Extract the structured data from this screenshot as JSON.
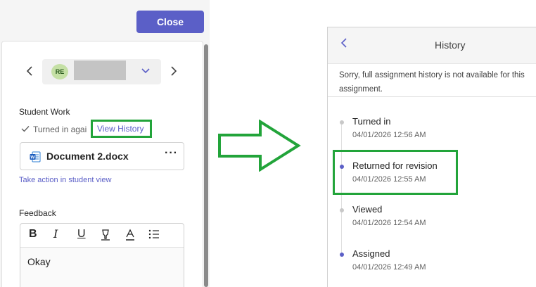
{
  "left_panel": {
    "close_label": "Close",
    "student": {
      "initials": "RE"
    },
    "student_work_label": "Student Work",
    "status_text": "Turned in agai",
    "view_history_label": "View History",
    "document": {
      "name": "Document 2.docx",
      "more": "···"
    },
    "take_action_label": "Take action in student view",
    "feedback_label": "Feedback",
    "feedback_text": "Okay",
    "toolbar": [
      "bold",
      "italic",
      "underline",
      "highlight",
      "font-color",
      "bullets"
    ]
  },
  "history_panel": {
    "title": "History",
    "note": "Sorry, full assignment history is not available for this assignment.",
    "events": [
      {
        "title": "Turned in",
        "time": "04/01/2026 12:56 AM",
        "dot": "#c8c8c8"
      },
      {
        "title": "Returned for revision",
        "time": "04/01/2026 12:55 AM",
        "dot": "#5b5fc7"
      },
      {
        "title": "Viewed",
        "time": "04/01/2026 12:54 AM",
        "dot": "#c8c8c8"
      },
      {
        "title": "Assigned",
        "time": "04/01/2026 12:49 AM",
        "dot": "#5b5fc7"
      }
    ]
  },
  "colors": {
    "accent": "#5b5fc7",
    "highlight": "#22a43a"
  }
}
